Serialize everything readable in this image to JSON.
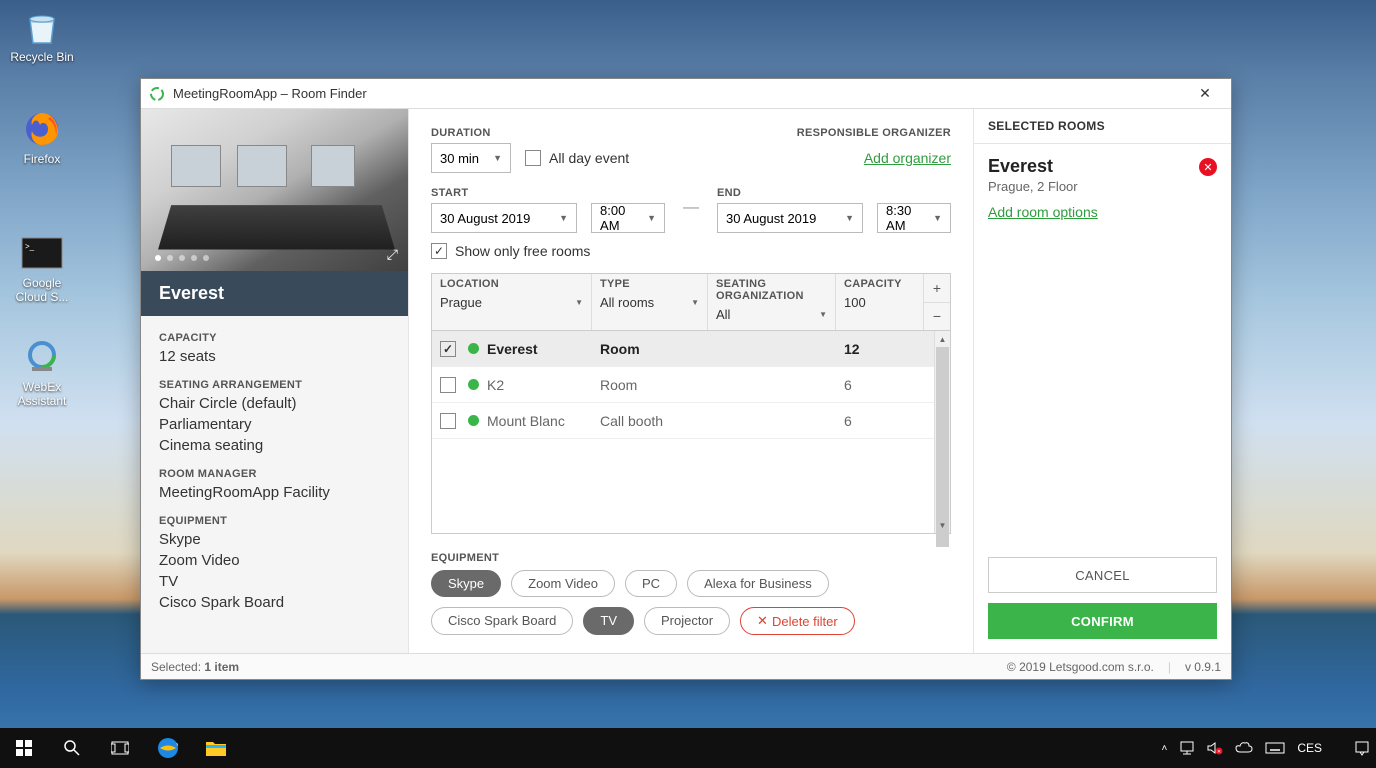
{
  "desktop": {
    "icons": [
      {
        "label": "Recycle Bin"
      },
      {
        "label": "Firefox"
      },
      {
        "label": "Google Cloud S..."
      },
      {
        "label": "WebEx Assistant"
      }
    ]
  },
  "taskbar": {
    "lang": "CES"
  },
  "window": {
    "title": "MeetingRoomApp – Room Finder",
    "statusbar": {
      "selected_label": "Selected:",
      "selected_count": "1 item",
      "copyright": "© 2019 Letsgood.com s.r.o.",
      "version": "v 0.9.1"
    }
  },
  "room_detail": {
    "name": "Everest",
    "capacity": {
      "label": "CAPACITY",
      "value": "12 seats"
    },
    "seating": {
      "label": "SEATING ARRANGEMENT",
      "values": [
        "Chair Circle (default)",
        "Parliamentary",
        "Cinema seating"
      ]
    },
    "manager": {
      "label": "ROOM MANAGER",
      "value": "MeetingRoomApp Facility"
    },
    "equipment": {
      "label": "EQUIPMENT",
      "values": [
        "Skype",
        "Zoom Video",
        "TV",
        "Cisco Spark Board"
      ]
    }
  },
  "form": {
    "duration": {
      "label": "DURATION",
      "value": "30 min"
    },
    "all_day": {
      "label": "All day event",
      "checked": false
    },
    "responsible": {
      "label": "RESPONSIBLE ORGANIZER",
      "add": "Add organizer"
    },
    "start": {
      "label": "START",
      "date": "30 August 2019",
      "time": "8:00 AM"
    },
    "end": {
      "label": "END",
      "date": "30 August 2019",
      "time": "8:30 AM"
    },
    "free_only": {
      "label": "Show only free rooms",
      "checked": true
    }
  },
  "table": {
    "headers": {
      "location": {
        "label": "LOCATION",
        "value": "Prague"
      },
      "type": {
        "label": "TYPE",
        "value": "All rooms"
      },
      "seating": {
        "label": "SEATING ORGANIZATION",
        "value": "All"
      },
      "capacity": {
        "label": "CAPACITY",
        "value": "100"
      }
    },
    "rows": [
      {
        "checked": true,
        "name": "Everest",
        "type": "Room",
        "capacity": "12"
      },
      {
        "checked": false,
        "name": "K2",
        "type": "Room",
        "capacity": "6"
      },
      {
        "checked": false,
        "name": "Mount Blanc",
        "type": "Call booth",
        "capacity": "6"
      }
    ]
  },
  "equipment_filter": {
    "label": "EQUIPMENT",
    "pills": [
      {
        "label": "Skype",
        "active": true
      },
      {
        "label": "Zoom Video",
        "active": false
      },
      {
        "label": "PC",
        "active": false
      },
      {
        "label": "Alexa for Business",
        "active": false
      },
      {
        "label": "Cisco Spark Board",
        "active": false
      },
      {
        "label": "TV",
        "active": true
      },
      {
        "label": "Projector",
        "active": false
      }
    ],
    "delete": "Delete filter"
  },
  "selected_panel": {
    "title": "SELECTED ROOMS",
    "room": {
      "name": "Everest",
      "location": "Prague, 2 Floor"
    },
    "add_options": "Add room options",
    "cancel": "CANCEL",
    "confirm": "CONFIRM"
  }
}
